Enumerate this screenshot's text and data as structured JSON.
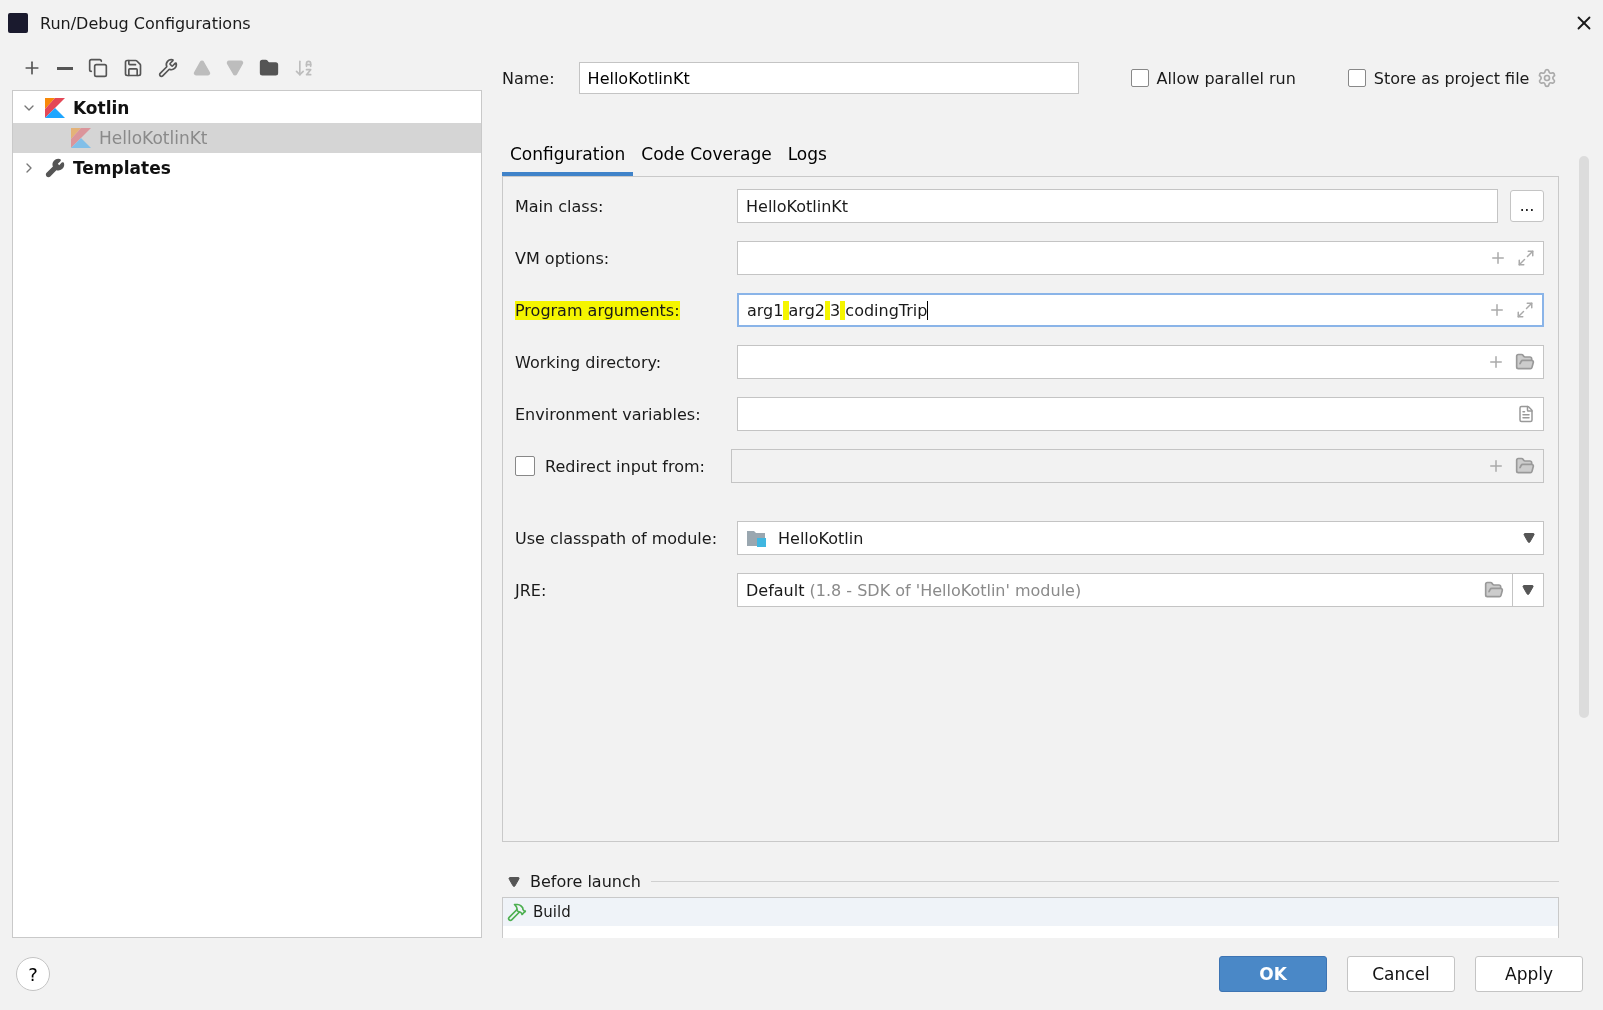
{
  "window": {
    "title": "Run/Debug Configurations"
  },
  "toolbar": [
    {
      "kind": "add",
      "disabled": false
    },
    {
      "kind": "remove",
      "disabled": false
    },
    {
      "kind": "copy",
      "disabled": false
    },
    {
      "kind": "save",
      "disabled": false
    },
    {
      "kind": "edit",
      "disabled": false
    },
    {
      "kind": "up",
      "disabled": true
    },
    {
      "kind": "down",
      "disabled": true
    },
    {
      "kind": "folder",
      "disabled": false
    },
    {
      "kind": "sort",
      "disabled": true
    }
  ],
  "tree": [
    {
      "kind": "kotlin",
      "label": "Kotlin",
      "expanded": true,
      "selected": false,
      "children": [
        {
          "kind": "kotlin",
          "label": "HelloKotlinKt",
          "selected": true
        }
      ]
    },
    {
      "kind": "templates",
      "label": "Templates",
      "expanded": false,
      "selected": false
    }
  ],
  "name_field": {
    "label": "Name:",
    "value": "HelloKotlinKt"
  },
  "options": [
    {
      "label": "Allow parallel run",
      "checked": false
    },
    {
      "label": "Store as project file",
      "checked": false
    }
  ],
  "tabs": [
    {
      "label": "Configuration",
      "selected": true
    },
    {
      "label": "Code Coverage",
      "selected": false
    },
    {
      "label": "Logs",
      "selected": false
    }
  ],
  "rows": [
    {
      "kind": "browse",
      "label": "Main class:",
      "value": "HelloKotlinKt",
      "button": "...",
      "focused": false
    },
    {
      "kind": "expand",
      "label": "VM options:",
      "focused": false
    },
    {
      "kind": "expand",
      "label": "Program arguments:",
      "value": "arg1 arg2 3 codingTrip",
      "highlighted": true,
      "focused": true
    },
    {
      "kind": "path",
      "label": "Working directory:",
      "focused": false
    },
    {
      "kind": "env",
      "label": "Environment variables:",
      "focused": false
    },
    {
      "kind": "redirect",
      "label": "Redirect input from:",
      "checked": false,
      "focused": false
    },
    {
      "kind": "module",
      "label": "Use classpath of module:",
      "value": "HelloKotlin",
      "focused": false
    },
    {
      "kind": "jre",
      "label": "JRE:",
      "value": "Default",
      "hint": "(1.8 - SDK of 'HelloKotlin' module)",
      "focused": false
    }
  ],
  "before_launch": {
    "title": "Before launch",
    "expanded": true,
    "tasks": [
      {
        "label": "Build"
      }
    ]
  },
  "help": "?",
  "buttons": [
    {
      "label": "OK",
      "primary": true
    },
    {
      "label": "Cancel",
      "primary": false
    },
    {
      "label": "Apply",
      "primary": false
    }
  ]
}
